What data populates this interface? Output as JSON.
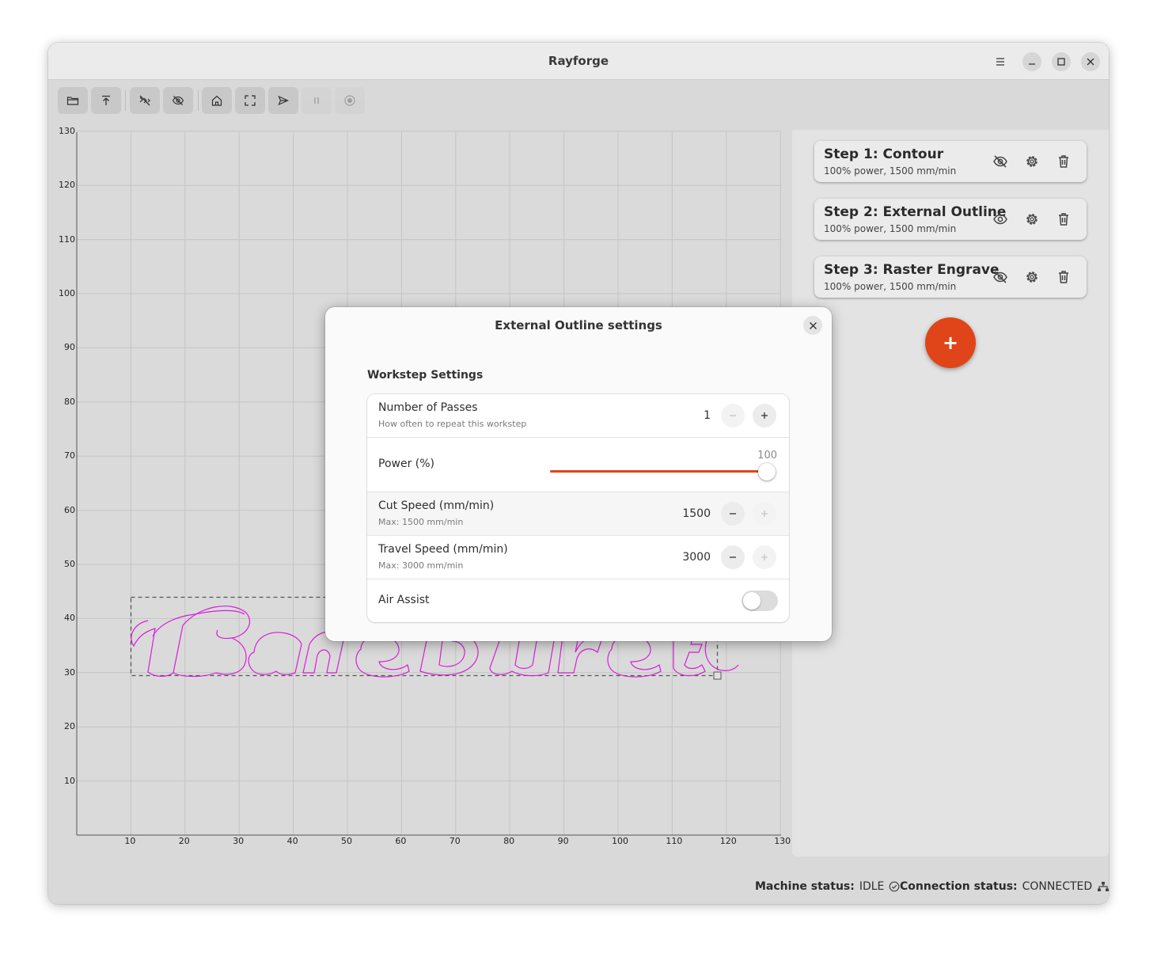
{
  "app": {
    "title": "Rayforge",
    "window_buttons": [
      "menu-icon",
      "minimize-icon",
      "maximize-icon",
      "close-icon"
    ]
  },
  "toolbar": {
    "buttons": [
      {
        "icon": "open-folder-icon",
        "enabled": true
      },
      {
        "icon": "import-icon",
        "enabled": true
      },
      {
        "icon": "hide-travel-icon",
        "enabled": true
      },
      {
        "icon": "hide-icon",
        "enabled": true
      },
      {
        "icon": "home-icon",
        "enabled": true
      },
      {
        "icon": "frame-icon",
        "enabled": true
      },
      {
        "icon": "send-icon",
        "enabled": true
      },
      {
        "icon": "pause-icon",
        "enabled": false
      },
      {
        "icon": "stop-icon",
        "enabled": false
      }
    ]
  },
  "canvas": {
    "x_ticks": [
      "10",
      "20",
      "30",
      "40",
      "50",
      "60",
      "70",
      "80",
      "90",
      "100",
      "110",
      "120",
      "130"
    ],
    "y_ticks": [
      "130",
      "120",
      "110",
      "100",
      "90",
      "80",
      "70",
      "60",
      "50",
      "40",
      "30",
      "20",
      "10"
    ],
    "path_color": "#d81ed8"
  },
  "steps": [
    {
      "title": "Step 1: Contour",
      "subtitle": "100% power, 1500 mm/min",
      "visibility_icon": "eye-slash-icon"
    },
    {
      "title": "Step 2: External Outline",
      "subtitle": "100% power, 1500 mm/min",
      "visibility_icon": "eye-icon"
    },
    {
      "title": "Step 3: Raster Engrave",
      "subtitle": "100% power, 1500 mm/min",
      "visibility_icon": "eye-slash-icon"
    }
  ],
  "add_step_label": "+",
  "status": {
    "machine_label": "Machine status:",
    "machine_value": "IDLE",
    "connection_label": "Connection status:",
    "connection_value": "CONNECTED"
  },
  "dialog": {
    "title": "External Outline settings",
    "section_title": "Workstep Settings",
    "passes": {
      "title": "Number of Passes",
      "subtitle": "How often to repeat this workstep",
      "value": "1"
    },
    "power": {
      "title": "Power (%)",
      "value": "100",
      "fraction": 1.0
    },
    "cut_speed": {
      "title": "Cut Speed (mm/min)",
      "subtitle": "Max: 1500 mm/min",
      "value": "1500"
    },
    "travel_speed": {
      "title": "Travel Speed (mm/min)",
      "subtitle": "Max: 3000 mm/min",
      "value": "3000"
    },
    "air_assist": {
      "title": "Air Assist",
      "enabled": false
    }
  },
  "colors": {
    "accent": "#e0451a"
  }
}
